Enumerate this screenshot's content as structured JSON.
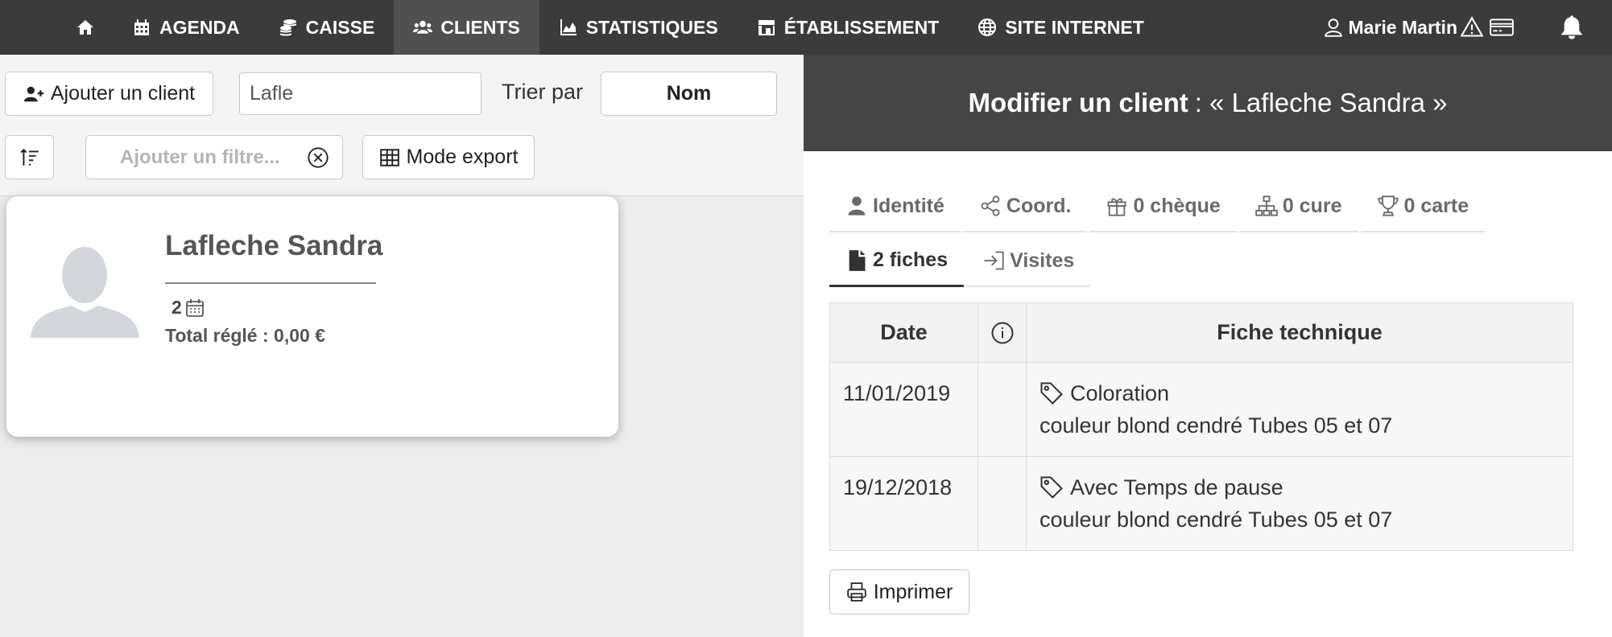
{
  "nav": {
    "home_icon": "home-icon",
    "items": [
      {
        "label": "AGENDA",
        "icon": "calendar-icon"
      },
      {
        "label": "CAISSE",
        "icon": "coins-icon"
      },
      {
        "label": "CLIENTS",
        "icon": "users-icon",
        "active": true
      },
      {
        "label": "STATISTIQUES",
        "icon": "chart-area-icon"
      },
      {
        "label": "ÉTABLISSEMENT",
        "icon": "store-icon"
      },
      {
        "label": "SITE INTERNET",
        "icon": "globe-icon"
      }
    ],
    "user_name": "Marie Martin",
    "colors": {
      "bar": "#3b3b3b",
      "active": "#505050"
    }
  },
  "toolbar": {
    "add_client_label": "Ajouter un client",
    "search_value": "Lafle",
    "sort_label": "Trier par",
    "sort_value": "Nom",
    "filter_placeholder": "Ajouter un filtre...",
    "export_label": "Mode export"
  },
  "client_card": {
    "name": "Lafleche Sandra",
    "visit_count": "2",
    "total_paid": "Total réglé : 0,00 €"
  },
  "panel": {
    "title_prefix": "Modifier un client",
    "title_suffix": ": « Lafleche Sandra »",
    "tabs": [
      {
        "label": "Identité",
        "icon": "user-icon"
      },
      {
        "label": "Coord.",
        "icon": "share-icon"
      },
      {
        "label": "0 chèque",
        "icon": "gift-icon"
      },
      {
        "label": "0 cure",
        "icon": "sitemap-icon"
      },
      {
        "label": "0 carte",
        "icon": "trophy-icon"
      },
      {
        "label": "2 fiches",
        "icon": "file-icon",
        "active": true
      },
      {
        "label": "Visites",
        "icon": "sign-in-icon"
      }
    ],
    "table": {
      "headers": {
        "date": "Date",
        "fiche": "Fiche technique"
      },
      "rows": [
        {
          "date": "11/01/2019",
          "title": "Coloration",
          "detail": "couleur blond cendré Tubes 05 et 07"
        },
        {
          "date": "19/12/2018",
          "title": "Avec Temps de pause",
          "detail": "couleur blond cendré Tubes 05 et 07"
        }
      ]
    },
    "print_label": "Imprimer"
  }
}
